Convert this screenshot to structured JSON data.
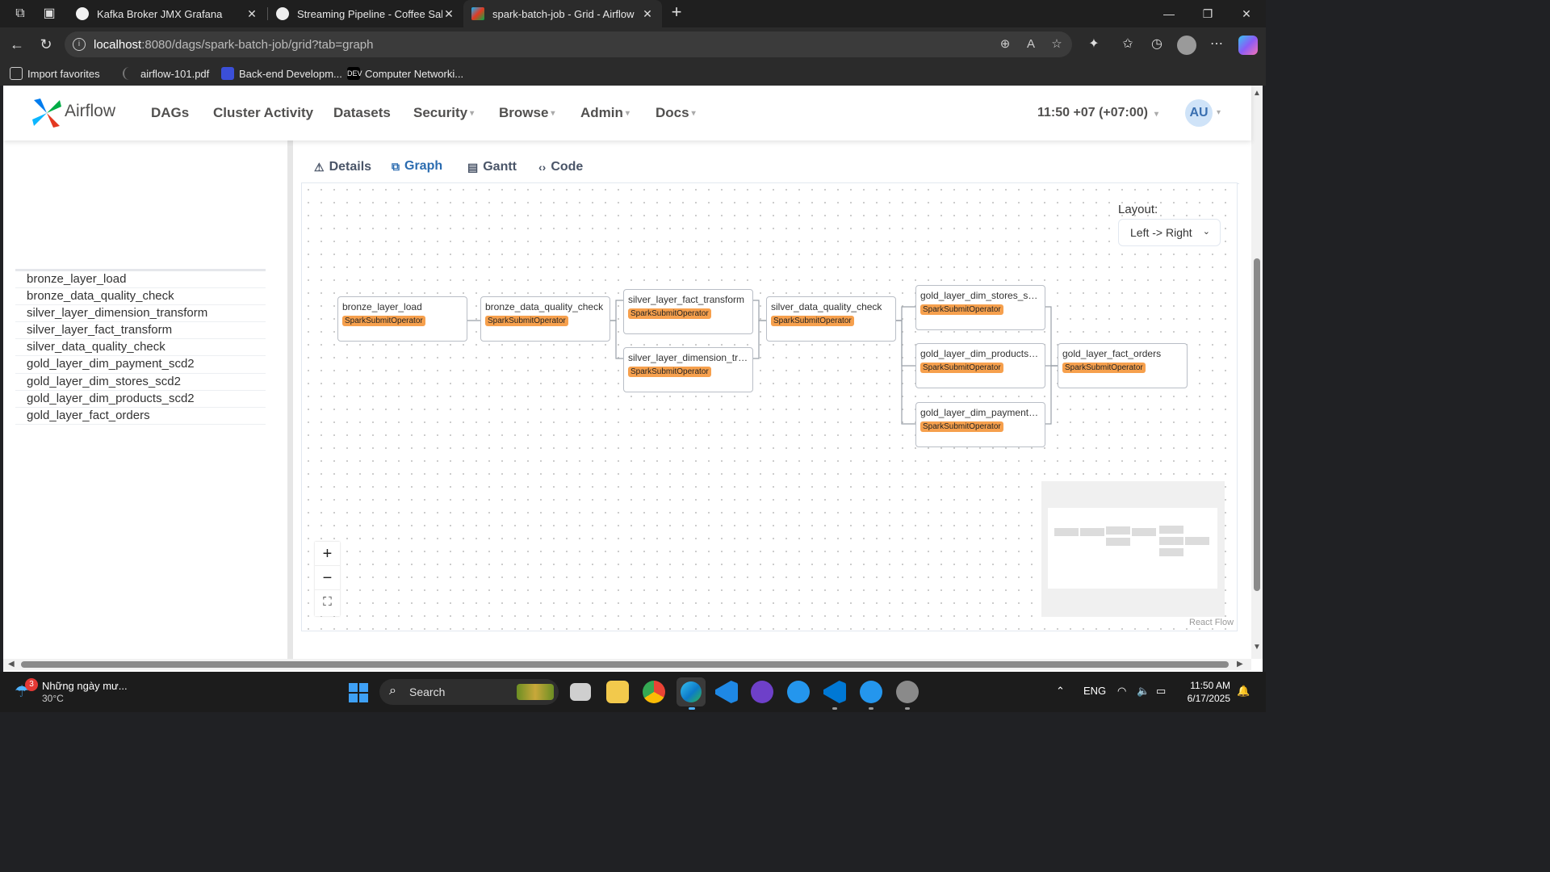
{
  "browser": {
    "tabs": [
      {
        "title": "Kafka Broker JMX Grafana",
        "icon": "grafana-icon",
        "color": "#e8e8e8"
      },
      {
        "title": "Streaming Pipeline - Coffee Sales",
        "icon": "streamlit-icon",
        "color": "#e8e8e8"
      },
      {
        "title": "spark-batch-job - Grid - Airflow",
        "icon": "airflow-icon",
        "color": "#e8e8e8"
      }
    ],
    "url_host": "localhost",
    "url_rest": ":8080/dags/spark-batch-job/grid?tab=graph",
    "bookmarks": [
      {
        "label": "Import favorites",
        "icon": "import-icon"
      },
      {
        "label": "airflow-101.pdf",
        "icon": "pdf-icon"
      },
      {
        "label": "Back-end Developm...",
        "icon": "roadmap-icon"
      },
      {
        "label": "Computer Networki...",
        "icon": "dev-icon",
        "icon_text": "DEV"
      }
    ]
  },
  "airflow": {
    "brand": "Airflow",
    "nav": [
      {
        "label": "DAGs",
        "has_menu": false
      },
      {
        "label": "Cluster Activity",
        "has_menu": false
      },
      {
        "label": "Datasets",
        "has_menu": false
      },
      {
        "label": "Security",
        "has_menu": true
      },
      {
        "label": "Browse",
        "has_menu": true
      },
      {
        "label": "Admin",
        "has_menu": true
      },
      {
        "label": "Docs",
        "has_menu": true
      }
    ],
    "time": "11:50 +07 (+07:00)",
    "user_initials": "AU",
    "task_list": [
      "bronze_layer_load",
      "bronze_data_quality_check",
      "silver_layer_dimension_transform",
      "silver_layer_fact_transform",
      "silver_data_quality_check",
      "gold_layer_dim_payment_scd2",
      "gold_layer_dim_stores_scd2",
      "gold_layer_dim_products_scd2",
      "gold_layer_fact_orders"
    ],
    "detail_tabs": [
      {
        "label": "Details",
        "icon": "warning-icon",
        "glyph": "⚠",
        "active": false
      },
      {
        "label": "Graph",
        "icon": "graph-icon",
        "glyph": "⧉",
        "active": true
      },
      {
        "label": "Gantt",
        "icon": "gantt-icon",
        "glyph": "▤",
        "active": false
      },
      {
        "label": "Code",
        "icon": "code-icon",
        "glyph": "‹›",
        "active": false
      }
    ],
    "graph": {
      "layout_label": "Layout:",
      "layout_value": "Left -> Right",
      "operator_color": "#f6a04d",
      "nodes": [
        {
          "name": "bronze_layer_load",
          "operator": "SparkSubmitOperator"
        },
        {
          "name": "bronze_data_quality_check",
          "operator": "SparkSubmitOperator"
        },
        {
          "name": "silver_layer_fact_transform",
          "operator": "SparkSubmitOperator"
        },
        {
          "name": "silver_layer_dimension_tra...",
          "operator": "SparkSubmitOperator"
        },
        {
          "name": "silver_data_quality_check",
          "operator": "SparkSubmitOperator"
        },
        {
          "name": "gold_layer_dim_stores_scd2",
          "operator": "SparkSubmitOperator"
        },
        {
          "name": "gold_layer_dim_products_s...",
          "operator": "SparkSubmitOperator"
        },
        {
          "name": "gold_layer_dim_payment_s...",
          "operator": "SparkSubmitOperator"
        },
        {
          "name": "gold_layer_fact_orders",
          "operator": "SparkSubmitOperator"
        }
      ],
      "zoom_controls": [
        "+",
        "−",
        "⛶"
      ],
      "attribution": "React Flow"
    }
  },
  "taskbar": {
    "weather_badge": "3",
    "weather_text": "Những ngày mư...",
    "temperature": "30°C",
    "search_placeholder": "Search",
    "language": "ENG",
    "time": "11:50 AM",
    "date": "6/17/2025"
  }
}
